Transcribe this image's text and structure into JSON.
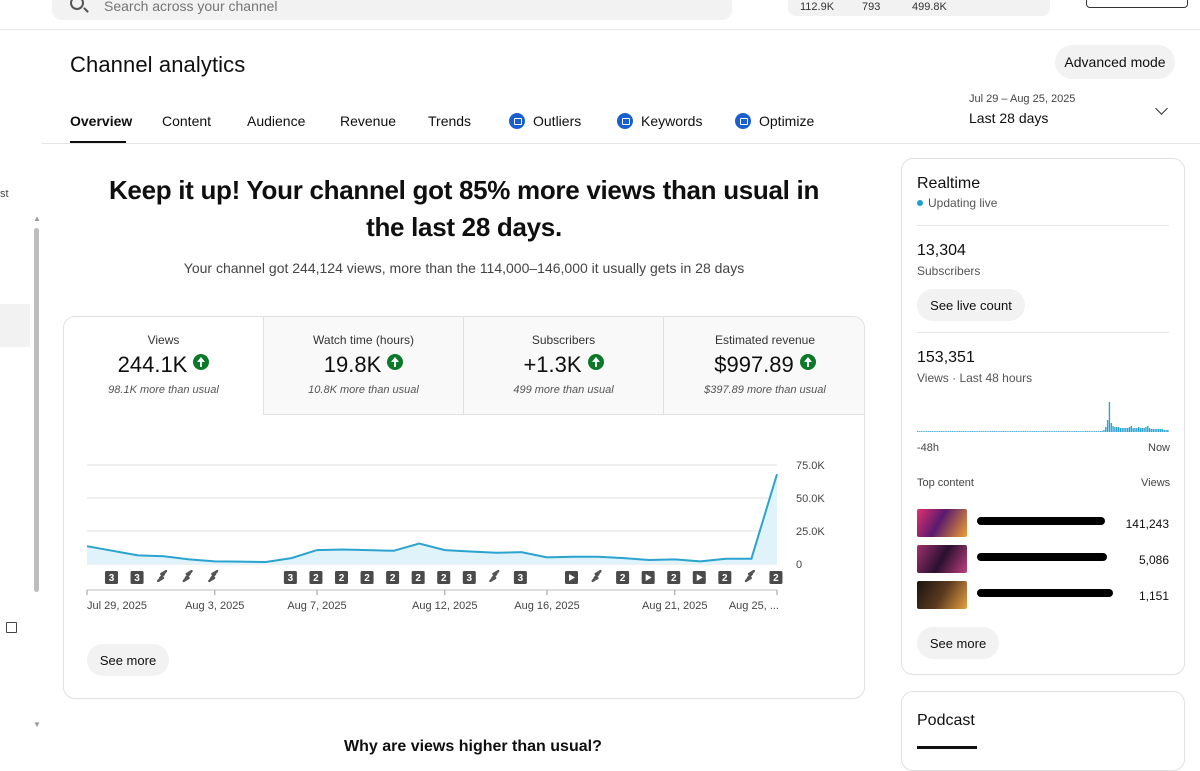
{
  "search": {
    "placeholder": "Search across your channel"
  },
  "topbar_stats": {
    "stat1": "112.9K",
    "stat2": "793",
    "stat3": "499.8K"
  },
  "sidebar": {
    "partial_label": "st"
  },
  "header": {
    "title": "Channel analytics",
    "advanced_mode": "Advanced mode",
    "date_range_sub": "Jul 29 – Aug 25, 2025",
    "date_range": "Last 28 days"
  },
  "tabs": [
    {
      "label": "Overview",
      "active": true
    },
    {
      "label": "Content"
    },
    {
      "label": "Audience"
    },
    {
      "label": "Revenue"
    },
    {
      "label": "Trends"
    },
    {
      "label": "Outliers",
      "badge": true
    },
    {
      "label": "Keywords",
      "badge": true
    },
    {
      "label": "Optimize",
      "badge": true
    }
  ],
  "headline": "Keep it up! Your channel got 85% more views than usual in the last 28 days.",
  "subhead": "Your channel got 244,124 views, more than the 114,000–146,000 it usually gets in 28 days",
  "metrics": [
    {
      "label": "Views",
      "value": "244.1K",
      "note": "98.1K more than usual"
    },
    {
      "label": "Watch time (hours)",
      "value": "19.8K",
      "note": "10.8K more than usual"
    },
    {
      "label": "Subscribers",
      "value": "+1.3K",
      "note": "499 more than usual"
    },
    {
      "label": "Estimated revenue",
      "value": "$997.89",
      "note": "$397.89 more than usual"
    }
  ],
  "chart_data": {
    "type": "area",
    "title": "",
    "xlabel": "",
    "ylabel": "",
    "ylim": [
      0,
      75000
    ],
    "yticks": [
      "0",
      "25.0K",
      "50.0K",
      "75.0K"
    ],
    "xtick_labels": [
      "Jul 29, 2025",
      "Aug 3, 2025",
      "Aug 7, 2025",
      "Aug 12, 2025",
      "Aug 16, 2025",
      "Aug 21, 2025",
      "Aug 25, ..."
    ],
    "x": [
      "Jul 29",
      "Jul 30",
      "Jul 31",
      "Aug 1",
      "Aug 2",
      "Aug 3",
      "Aug 4",
      "Aug 5",
      "Aug 6",
      "Aug 7",
      "Aug 8",
      "Aug 9",
      "Aug 10",
      "Aug 11",
      "Aug 12",
      "Aug 13",
      "Aug 14",
      "Aug 15",
      "Aug 16",
      "Aug 17",
      "Aug 18",
      "Aug 19",
      "Aug 20",
      "Aug 21",
      "Aug 22",
      "Aug 23",
      "Aug 24",
      "Aug 25"
    ],
    "series": [
      {
        "values": [
          13500,
          10000,
          6500,
          5800,
          3500,
          2000,
          1800,
          1500,
          4500,
          10500,
          11000,
          10500,
          10000,
          15500,
          10500,
          9500,
          8500,
          9000,
          5000,
          5500,
          5500,
          4500,
          3000,
          3500,
          2000,
          4000,
          4000,
          68000
        ]
      }
    ],
    "markers": [
      "3",
      "3",
      "short",
      "short",
      "short",
      "",
      "",
      "3",
      "2",
      "2",
      "2",
      "2",
      "2",
      "2",
      "3",
      "short",
      "3",
      "",
      "video",
      "short",
      "2",
      "video",
      "2",
      "video",
      "2",
      "short",
      "2",
      ""
    ]
  },
  "see_more": "See more",
  "why_text": "Why are views higher than usual?",
  "realtime": {
    "title": "Realtime",
    "live": "Updating live",
    "subscribers": "13,304",
    "subscribers_label": "Subscribers",
    "live_count": "See live count",
    "views": "153,351",
    "views_label": "Views · Last 48 hours",
    "spark_left": "-48h",
    "spark_right": "Now",
    "spark_values": [
      0,
      0,
      0,
      0,
      0,
      0,
      0,
      0,
      0,
      0,
      0,
      0,
      0,
      0,
      0,
      0,
      0,
      0,
      0,
      0,
      0,
      0,
      0,
      0,
      0,
      0,
      0,
      0,
      0,
      0,
      0,
      0,
      0,
      0,
      0,
      0,
      0,
      0,
      0,
      0,
      0,
      0,
      0,
      0,
      0,
      0,
      0,
      0,
      0,
      0,
      0,
      0,
      0,
      0,
      0,
      0,
      0,
      0,
      0,
      0,
      0,
      0,
      0,
      0,
      0,
      0,
      0,
      0,
      0,
      0,
      0,
      0,
      0,
      0,
      0,
      0,
      0,
      0,
      0,
      0,
      0,
      0,
      0,
      0,
      0,
      0,
      0,
      0,
      0,
      0,
      0,
      0,
      0,
      0,
      0,
      0,
      0,
      0,
      0,
      0,
      0,
      1,
      2,
      5,
      12,
      30,
      9,
      6,
      5,
      5,
      5,
      4,
      4,
      4,
      4,
      4,
      5,
      6,
      4,
      4,
      4,
      5,
      4,
      4,
      4,
      5,
      6,
      4,
      3,
      3,
      3,
      3,
      3,
      3,
      3,
      2,
      2,
      2
    ],
    "top_content_label": "Top content",
    "views_col": "Views",
    "top_items": [
      {
        "views": "141,243",
        "thumb": "#c0286a"
      },
      {
        "views": "5,086",
        "thumb": "#7a2d5a"
      },
      {
        "views": "1,151",
        "thumb": "#3a2a1e"
      }
    ],
    "see_more": "See more"
  },
  "podcast": {
    "title": "Podcast"
  }
}
